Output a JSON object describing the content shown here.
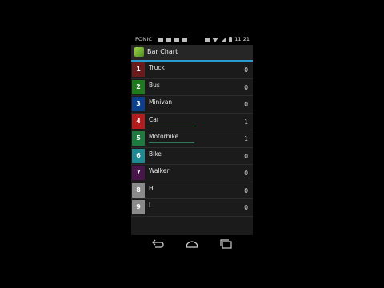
{
  "status_bar": {
    "carrier": "FONIC",
    "time": "11:21"
  },
  "action_bar": {
    "title": "Bar Chart",
    "app_icon": "pencil-chart-icon"
  },
  "chart_data": {
    "type": "bar",
    "categories": [
      "Truck",
      "Bus",
      "Minivan",
      "Car",
      "Motorbike",
      "Bike",
      "Walker",
      "H",
      "I"
    ],
    "values": [
      0,
      0,
      0,
      1,
      1,
      0,
      0,
      0,
      0
    ],
    "indices": [
      "1",
      "2",
      "3",
      "4",
      "5",
      "6",
      "7",
      "8",
      "9"
    ],
    "colors": [
      "#6a1b1b",
      "#1e7a1e",
      "#0d3f8f",
      "#b31d1d",
      "#1f7a3f",
      "#1f8a93",
      "#4a154a",
      "#8a8a8a",
      "#8a8a8a"
    ],
    "bar_colors": [
      "#6a1b1b",
      "#1e7a1e",
      "#0d3f8f",
      "#c62828",
      "#2e7d5a",
      "#1f8a93",
      "#4a154a",
      "#8a8a8a",
      "#8a8a8a"
    ],
    "max_value": 1
  },
  "nav_bar": {
    "back_icon": "back-icon",
    "home_icon": "home-icon",
    "recents_icon": "recent-apps-icon"
  }
}
